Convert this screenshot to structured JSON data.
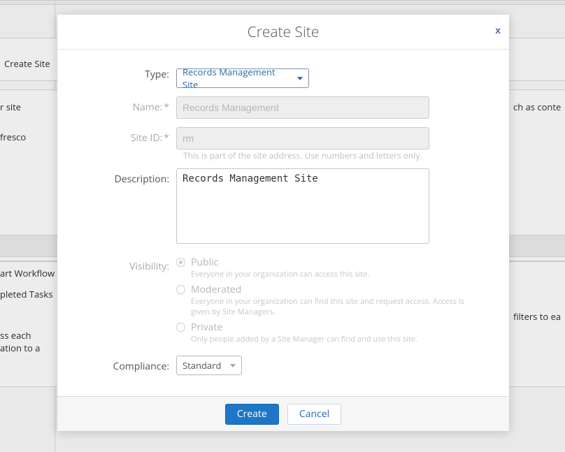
{
  "dialog": {
    "title": "Create Site",
    "labels": {
      "type": "Type:",
      "name": "Name:",
      "site_id": "Site ID:",
      "description": "Description:",
      "visibility": "Visibility:",
      "compliance": "Compliance:"
    },
    "type_selected": "Records Management Site",
    "name_placeholder": "Records Management",
    "siteid_placeholder": "rm",
    "siteid_hint": "This is part of the site address. Use numbers and letters only.",
    "description_value": "Records Management Site",
    "visibility": {
      "selected": "public",
      "options": {
        "public": {
          "label": "Public",
          "desc": "Everyone in your organization can access this site."
        },
        "moderated": {
          "label": "Moderated",
          "desc": "Everyone in your organization can find this site and request access. Access is given by Site Managers."
        },
        "private": {
          "label": "Private",
          "desc": "Only people added by a Site Manager can find and use this site."
        }
      }
    },
    "compliance_selected": "Standard",
    "buttons": {
      "create": "Create",
      "cancel": "Cancel"
    }
  },
  "background": {
    "create_site": "Create Site",
    "r_site": "r site",
    "fresco": "fresco",
    "art_workflow": "art Workflow",
    "pleted_tasks": "pleted Tasks",
    "ss_each": "ss each",
    "ation_to_a": "ation to a",
    "ch_as_conte": "ch as conte",
    "filters_to_ea": "filters to ea"
  }
}
